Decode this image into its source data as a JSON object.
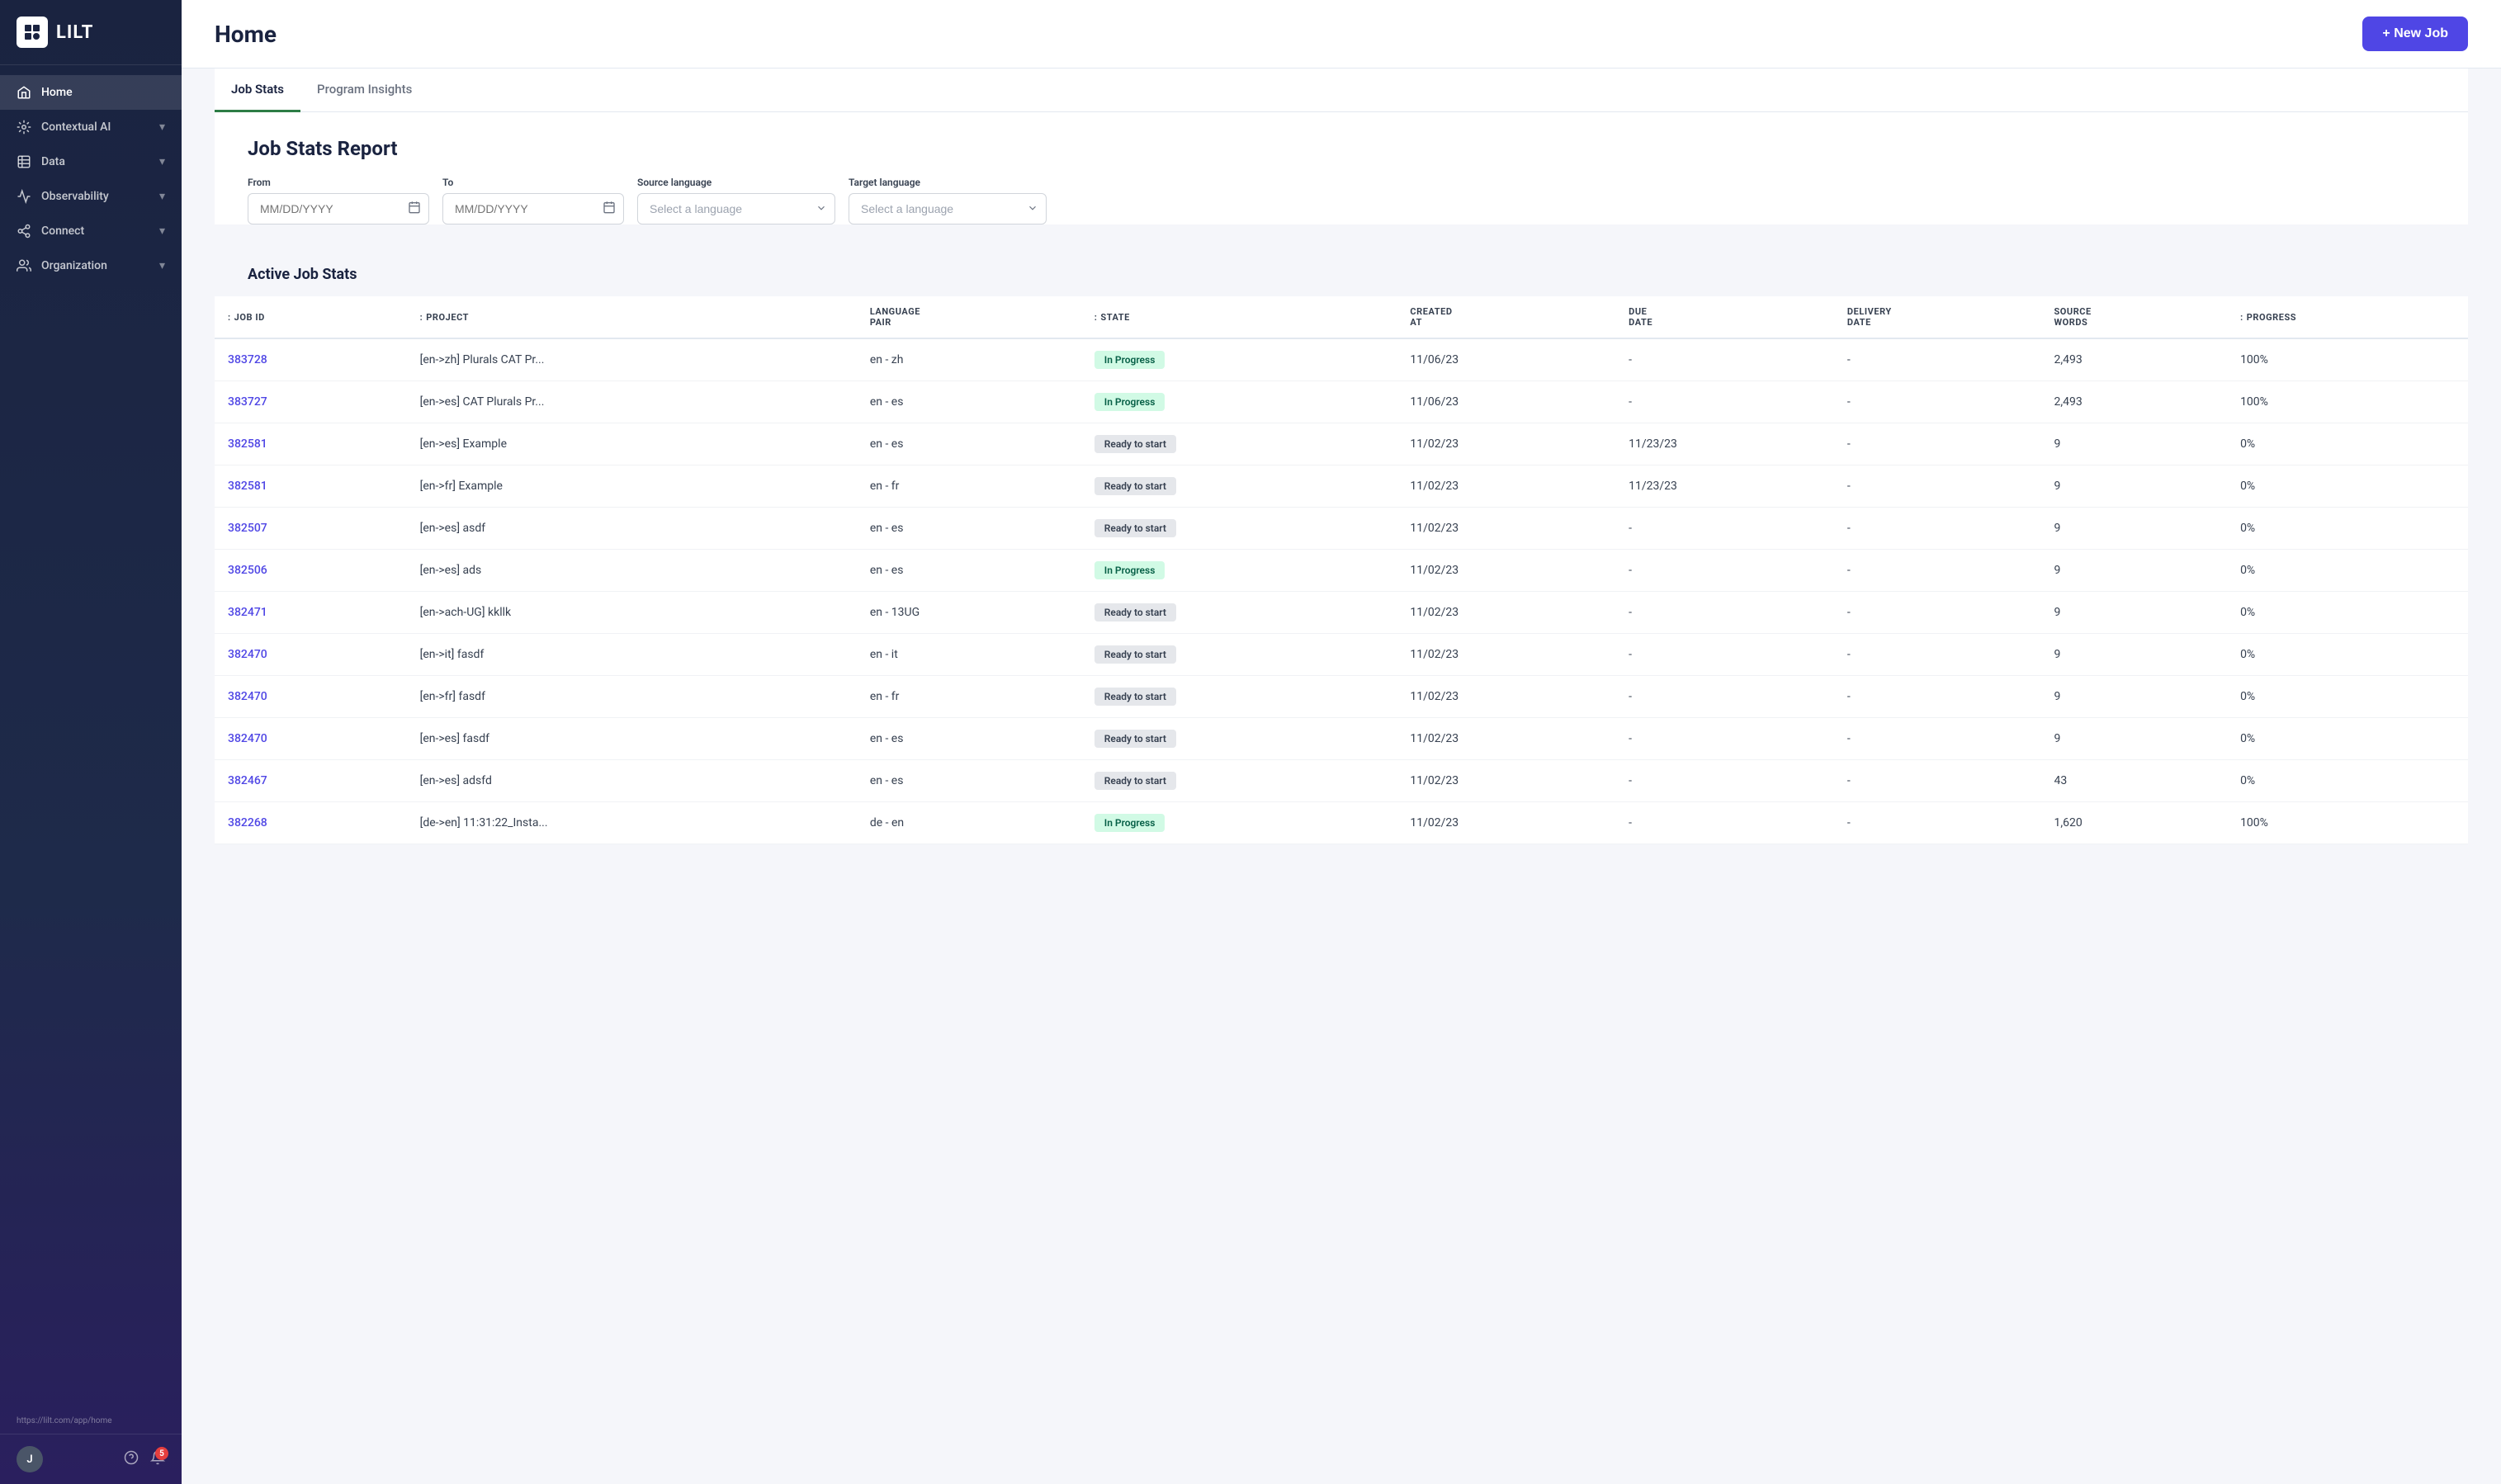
{
  "sidebar": {
    "logo_text": "LILT",
    "nav_items": [
      {
        "id": "home",
        "label": "Home",
        "active": true,
        "has_chevron": false
      },
      {
        "id": "contextual-ai",
        "label": "Contextual AI",
        "active": false,
        "has_chevron": true
      },
      {
        "id": "data",
        "label": "Data",
        "active": false,
        "has_chevron": true
      },
      {
        "id": "observability",
        "label": "Observability",
        "active": false,
        "has_chevron": true
      },
      {
        "id": "connect",
        "label": "Connect",
        "active": false,
        "has_chevron": true
      },
      {
        "id": "organization",
        "label": "Organization",
        "active": false,
        "has_chevron": true
      }
    ],
    "user_initial": "J",
    "notification_count": "5",
    "url": "https://lilt.com/app/home"
  },
  "header": {
    "title": "Home",
    "new_job_label": "+ New Job"
  },
  "tabs": [
    {
      "id": "job-stats",
      "label": "Job Stats",
      "active": true
    },
    {
      "id": "program-insights",
      "label": "Program Insights",
      "active": false
    }
  ],
  "report": {
    "title": "Job Stats Report",
    "filters": {
      "from_label": "From",
      "from_placeholder": "MM/DD/YYYY",
      "to_label": "To",
      "to_placeholder": "MM/DD/YYYY",
      "source_label": "Source language",
      "source_placeholder": "Select a language",
      "target_label": "Target language",
      "target_placeholder": "Select a language"
    }
  },
  "active_stats": {
    "title": "Active Job Stats",
    "columns": [
      "JOB ID",
      "PROJECT",
      "LANGUAGE PAIR",
      "STATE",
      "CREATED AT",
      "DUE DATE",
      "DELIVERY DATE",
      "SOURCE WORDS",
      "PROGRESS"
    ],
    "rows": [
      {
        "job_id": "383728",
        "project": "[en->zh] Plurals CAT Pr...",
        "lang_pair": "en - zh",
        "state": "In Progress",
        "state_type": "in-progress",
        "created_at": "11/06/23",
        "due_date": "-",
        "delivery_date": "-",
        "source_words": "2,493",
        "progress": "100%"
      },
      {
        "job_id": "383727",
        "project": "[en->es] CAT Plurals Pr...",
        "lang_pair": "en - es",
        "state": "In Progress",
        "state_type": "in-progress",
        "created_at": "11/06/23",
        "due_date": "-",
        "delivery_date": "-",
        "source_words": "2,493",
        "progress": "100%"
      },
      {
        "job_id": "382581",
        "project": "[en->es] Example",
        "lang_pair": "en - es",
        "state": "Ready to start",
        "state_type": "ready",
        "created_at": "11/02/23",
        "due_date": "11/23/23",
        "delivery_date": "-",
        "source_words": "9",
        "progress": "0%"
      },
      {
        "job_id": "382581",
        "project": "[en->fr] Example",
        "lang_pair": "en - fr",
        "state": "Ready to start",
        "state_type": "ready",
        "created_at": "11/02/23",
        "due_date": "11/23/23",
        "delivery_date": "-",
        "source_words": "9",
        "progress": "0%"
      },
      {
        "job_id": "382507",
        "project": "[en->es] asdf",
        "lang_pair": "en - es",
        "state": "Ready to start",
        "state_type": "ready",
        "created_at": "11/02/23",
        "due_date": "-",
        "delivery_date": "-",
        "source_words": "9",
        "progress": "0%"
      },
      {
        "job_id": "382506",
        "project": "[en->es] ads",
        "lang_pair": "en - es",
        "state": "In Progress",
        "state_type": "in-progress",
        "created_at": "11/02/23",
        "due_date": "-",
        "delivery_date": "-",
        "source_words": "9",
        "progress": "0%"
      },
      {
        "job_id": "382471",
        "project": "[en->ach-UG] kkllk",
        "lang_pair": "en - 13UG",
        "state": "Ready to start",
        "state_type": "ready",
        "created_at": "11/02/23",
        "due_date": "-",
        "delivery_date": "-",
        "source_words": "9",
        "progress": "0%"
      },
      {
        "job_id": "382470",
        "project": "[en->it] fasdf",
        "lang_pair": "en - it",
        "state": "Ready to start",
        "state_type": "ready",
        "created_at": "11/02/23",
        "due_date": "-",
        "delivery_date": "-",
        "source_words": "9",
        "progress": "0%"
      },
      {
        "job_id": "382470",
        "project": "[en->fr] fasdf",
        "lang_pair": "en - fr",
        "state": "Ready to start",
        "state_type": "ready",
        "created_at": "11/02/23",
        "due_date": "-",
        "delivery_date": "-",
        "source_words": "9",
        "progress": "0%"
      },
      {
        "job_id": "382470",
        "project": "[en->es] fasdf",
        "lang_pair": "en - es",
        "state": "Ready to start",
        "state_type": "ready",
        "created_at": "11/02/23",
        "due_date": "-",
        "delivery_date": "-",
        "source_words": "9",
        "progress": "0%"
      },
      {
        "job_id": "382467",
        "project": "[en->es] adsfd",
        "lang_pair": "en - es",
        "state": "Ready to start",
        "state_type": "ready",
        "created_at": "11/02/23",
        "due_date": "-",
        "delivery_date": "-",
        "source_words": "43",
        "progress": "0%"
      },
      {
        "job_id": "382268",
        "project": "[de->en] 11:31:22_Insta...",
        "lang_pair": "de - en",
        "state": "In Progress",
        "state_type": "in-progress",
        "created_at": "11/02/23",
        "due_date": "-",
        "delivery_date": "-",
        "source_words": "1,620",
        "progress": "100%"
      }
    ]
  }
}
